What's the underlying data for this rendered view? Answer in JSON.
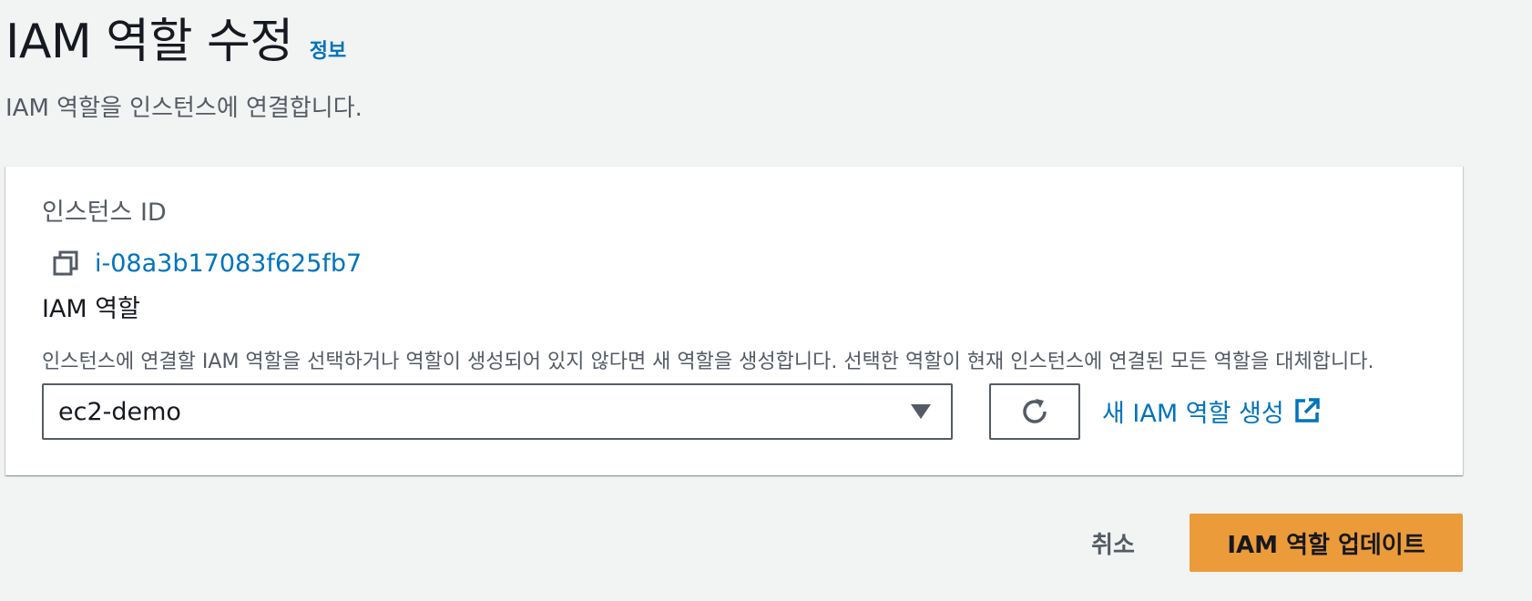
{
  "header": {
    "title": "IAM 역할 수정",
    "info_link": "정보",
    "subtitle": "IAM 역할을 인스턴스에 연결합니다."
  },
  "form": {
    "instance_id_label": "인스턴스 ID",
    "instance_id_value": "i-08a3b17083f625fb7",
    "copy_icon": "copy-icon",
    "iam_role_label": "IAM 역할",
    "iam_role_description": "인스턴스에 연결할 IAM 역할을 선택하거나 역할이 생성되어 있지 않다면 새 역할을 생성합니다. 선택한 역할이 현재 인스턴스에 연결된 모든 역할을 대체합니다.",
    "iam_role_selected": "ec2-demo",
    "refresh_icon": "refresh-icon",
    "create_role_link": "새 IAM 역할 생성",
    "external_icon": "external-link-icon"
  },
  "actions": {
    "cancel_label": "취소",
    "submit_label": "IAM 역할 업데이트"
  },
  "colors": {
    "background": "#f2f3f3",
    "link": "#0073bb",
    "primary_button": "#ec9b3a",
    "text": "#16191f",
    "muted_text": "#545b64"
  }
}
